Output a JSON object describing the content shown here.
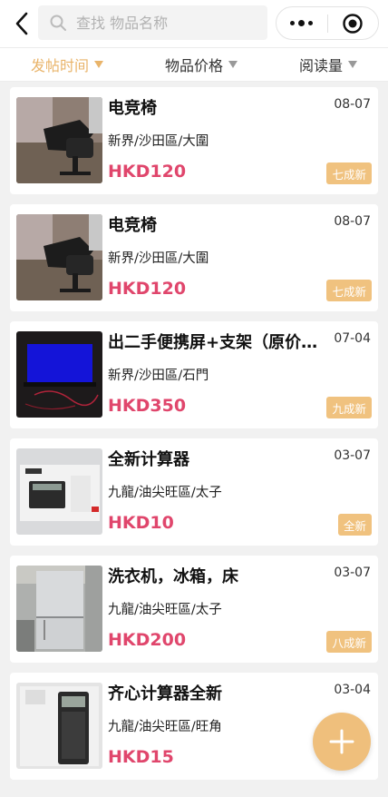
{
  "header": {
    "search_placeholder": "查找 物品名称",
    "icons": [
      "back-arrow-icon",
      "search-icon",
      "more-dots-icon",
      "target-icon"
    ]
  },
  "sort_bar": {
    "items": [
      {
        "label": "发帖时间",
        "active": true
      },
      {
        "label": "物品价格",
        "active": false
      },
      {
        "label": "阅读量",
        "active": false
      }
    ]
  },
  "listings": [
    {
      "title": "电竞椅",
      "date": "08-07",
      "location": "新界/沙田區/大圍",
      "price": "HKD120",
      "condition": "七成新",
      "image": "gaming-chair-photo"
    },
    {
      "title": "电竞椅",
      "date": "08-07",
      "location": "新界/沙田區/大圍",
      "price": "HKD120",
      "condition": "七成新",
      "image": "gaming-chair-photo"
    },
    {
      "title": "出二手便携屏+支架（原价…",
      "date": "07-04",
      "location": "新界/沙田區/石門",
      "price": "HKD350",
      "condition": "九成新",
      "image": "portable-monitor-photo"
    },
    {
      "title": "全新计算器",
      "date": "03-07",
      "location": "九龍/油尖旺區/太子",
      "price": "HKD10",
      "condition": "全新",
      "image": "calculator-box-photo"
    },
    {
      "title": "洗衣机，冰箱，床",
      "date": "03-07",
      "location": "九龍/油尖旺區/太子",
      "price": "HKD200",
      "condition": "八成新",
      "image": "fridge-photo"
    },
    {
      "title": "齐心计算器全新",
      "date": "03-04",
      "location": "九龍/油尖旺區/旺角",
      "price": "HKD15",
      "condition": "",
      "image": "scientific-calculator-photo"
    }
  ],
  "fab": {
    "icon": "plus-icon"
  },
  "colors": {
    "accent": "#e9b46a",
    "price": "#e0466c",
    "badge": "#f0c27f",
    "fab": "#efbf7c"
  }
}
